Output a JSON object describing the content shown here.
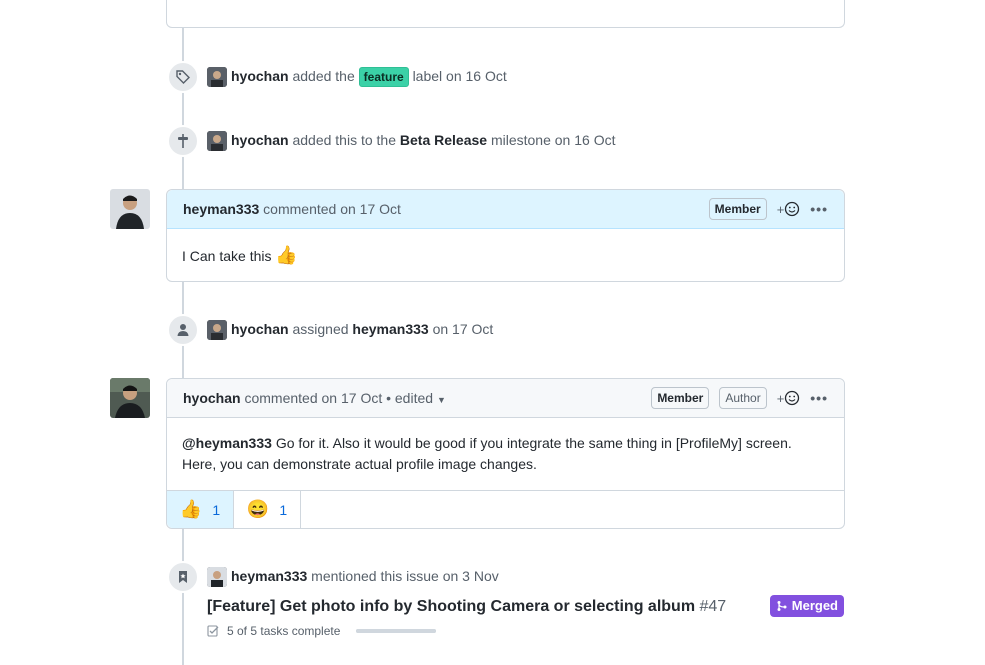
{
  "events": {
    "label_event": {
      "user": "hyochan",
      "text_before": "added the",
      "label": "feature",
      "text_after": "label",
      "date": "on 16 Oct"
    },
    "milestone_event": {
      "user": "hyochan",
      "text_before": "added this to the",
      "milestone": "Beta Release",
      "text_after": "milestone",
      "date": "on 16 Oct"
    },
    "assign_event": {
      "user": "hyochan",
      "text_before": "assigned",
      "assignee": "heyman333",
      "date": "on 17 Oct"
    },
    "mention_event": {
      "user": "heyman333",
      "text_before": "mentioned this issue",
      "date": "on 3 Nov",
      "pr_title": "[Feature] Get photo info by Shooting Camera or selecting album",
      "pr_number": "#47",
      "pr_status": "Merged",
      "tasks": "5 of 5 tasks complete",
      "tasks_fraction": 1.0
    }
  },
  "comment1": {
    "author": "heyman333",
    "action": "commented",
    "date": "on 17 Oct",
    "role": "Member",
    "reaction_add": "+",
    "body": "I Can take this",
    "body_emoji": "👍"
  },
  "comment2": {
    "author": "hyochan",
    "action": "commented",
    "date": "on 17 Oct",
    "edited": "• edited",
    "role_member": "Member",
    "role_author": "Author",
    "reaction_add": "+",
    "mention": "@heyman333",
    "body_line1": "Go for it. Also it would be good if you integrate the same thing in [ProfileMy] screen.",
    "body_line2": "Here, you can demonstrate actual profile image changes.",
    "reactions": [
      {
        "emoji": "👍",
        "count": "1"
      },
      {
        "emoji": "😄",
        "count": "1"
      }
    ]
  },
  "colors": {
    "accent": "#0969da",
    "label_feature": "#3bd1a7",
    "merged": "#8250df",
    "comment_header_blue": "#ddf4ff"
  }
}
